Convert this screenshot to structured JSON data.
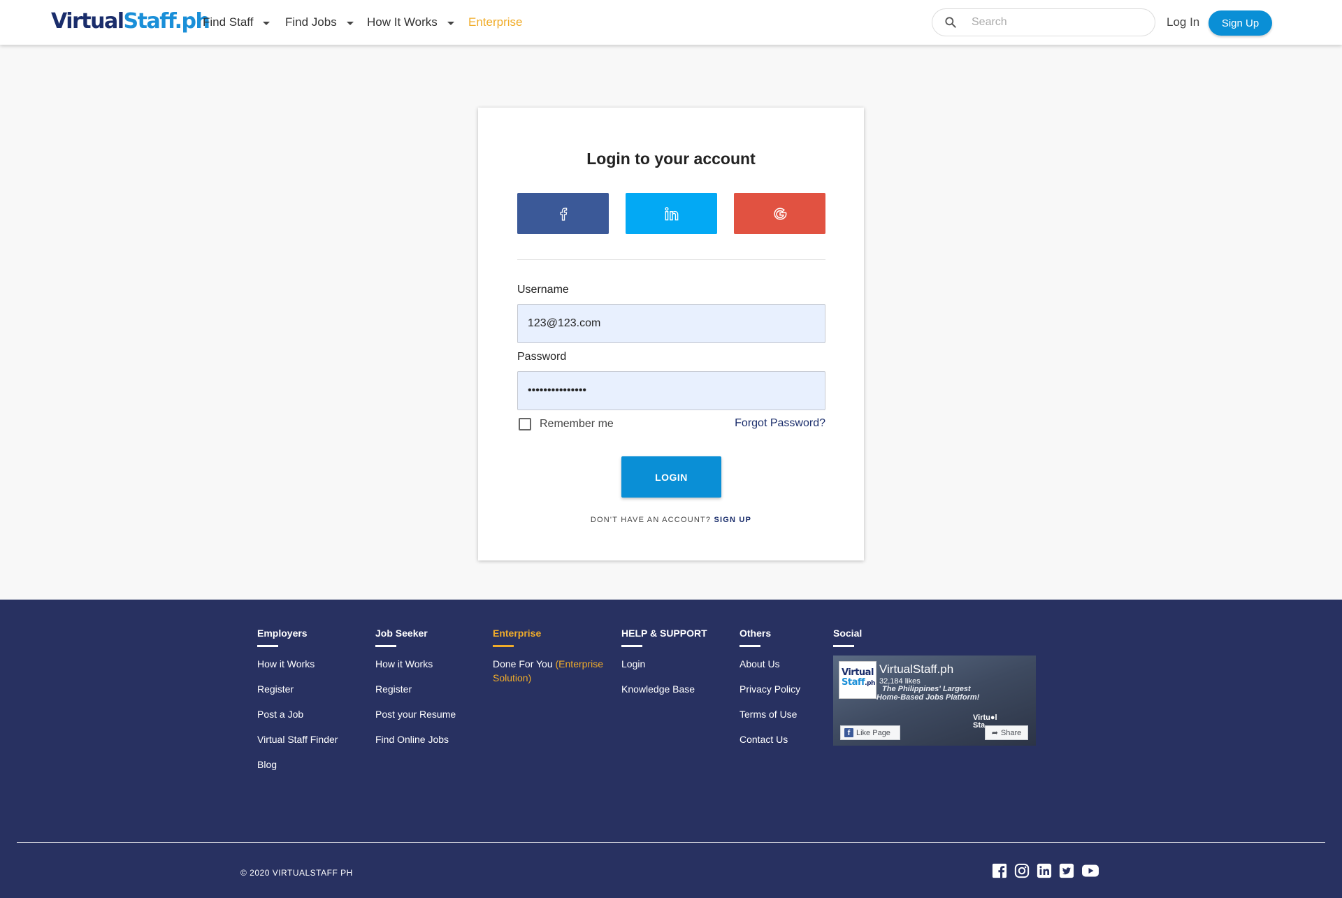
{
  "header": {
    "logo": {
      "part1": "Virtu",
      "part2": "al",
      "part3": "Staff.ph"
    },
    "nav": [
      {
        "label": "Find Staff",
        "has_caret": true
      },
      {
        "label": "Find Jobs",
        "has_caret": true
      },
      {
        "label": "How It Works",
        "has_caret": true
      },
      {
        "label": "Enterprise",
        "has_caret": false
      }
    ],
    "search": {
      "placeholder": "Search",
      "value": "",
      "icon": "search-icon"
    },
    "login_label": "Log In",
    "signup_label": "Sign Up"
  },
  "login": {
    "title": "Login to your account",
    "social": [
      {
        "name": "facebook",
        "icon": "facebook-icon",
        "color": "#3b5998"
      },
      {
        "name": "linkedin",
        "icon": "linkedin-icon",
        "color": "#03a9f4"
      },
      {
        "name": "google",
        "icon": "google-icon",
        "color": "#e15241"
      }
    ],
    "username_label": "Username",
    "username_value": "123@123.com",
    "password_label": "Password",
    "password_value": "•••••••••••••••",
    "remember_label": "Remember me",
    "remember_checked": false,
    "forgot_label": "Forgot Password?",
    "login_button": "LOGIN",
    "no_account_text": "DON'T HAVE AN ACCOUNT?",
    "signup_link": "SIGN UP"
  },
  "footer": {
    "columns": [
      {
        "heading": "Employers",
        "links": [
          "How it Works",
          "Register",
          "Post a Job",
          "Virtual Staff Finder",
          "Blog"
        ]
      },
      {
        "heading": "Job Seeker",
        "links": [
          "How it Works",
          "Register",
          "Post your Resume",
          "Find Online Jobs"
        ]
      },
      {
        "heading": "Enterprise",
        "links": [
          {
            "text": "Done For You",
            "highlight": "(Enterprise",
            "line2": "Solution)"
          }
        ]
      },
      {
        "heading": "HELP & SUPPORT",
        "links": [
          "Login",
          "Knowledge Base"
        ]
      },
      {
        "heading": "Others",
        "links": [
          "About Us",
          "Privacy Policy",
          "Terms of Use",
          "Contact Us"
        ]
      },
      {
        "heading": "Social",
        "links": []
      }
    ],
    "fb_widget": {
      "page_name": "VirtualStaff.ph",
      "likes": "32,184 likes",
      "tagline1": "The Philippines' Largest",
      "tagline2": "Home-Based Jobs Platform!",
      "like_button": "Like Page",
      "share_button": "Share"
    },
    "copyright": "© 2020 VIRTUALSTAFF PH",
    "social_icons": [
      "facebook-icon",
      "instagram-icon",
      "linkedin-icon",
      "twitter-icon",
      "youtube-icon"
    ]
  },
  "colors": {
    "brand_blue": "#0a8fd6",
    "navy": "#283161",
    "accent_orange": "#f0ac2a",
    "facebook": "#3b5998",
    "linkedin": "#03a9f4",
    "google": "#e15241"
  }
}
